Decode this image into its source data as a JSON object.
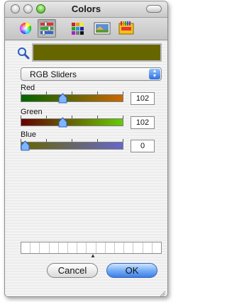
{
  "window": {
    "title": "Colors"
  },
  "toolbar": {
    "tabs": [
      {
        "name": "color-wheel",
        "selected": false
      },
      {
        "name": "color-sliders",
        "selected": true
      },
      {
        "name": "color-palettes",
        "selected": false
      },
      {
        "name": "image-palettes",
        "selected": false
      },
      {
        "name": "crayons",
        "selected": false
      }
    ]
  },
  "current_color": "#666600",
  "mode_select": {
    "selected": "RGB Sliders"
  },
  "sliders": [
    {
      "label": "Red",
      "value": "102",
      "level": 0.4
    },
    {
      "label": "Green",
      "value": "102",
      "level": 0.4
    },
    {
      "label": "Blue",
      "value": "0",
      "level": 0.0
    }
  ],
  "buttons": {
    "cancel": "Cancel",
    "ok": "OK"
  },
  "icons": {
    "search": "magnifier-icon",
    "dropdown": "up-down-arrows-icon"
  }
}
